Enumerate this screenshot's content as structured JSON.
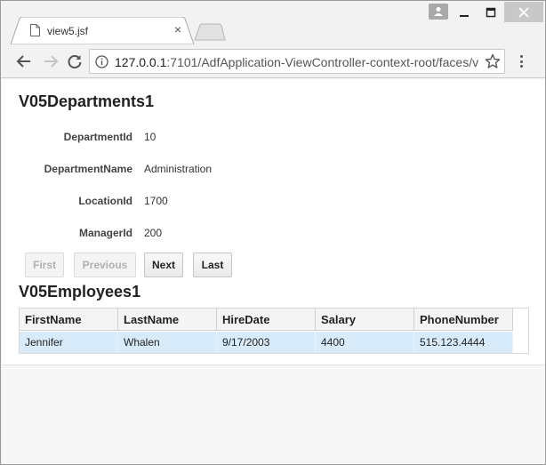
{
  "browser": {
    "tab_title": "view5.jsf",
    "tab_close": "×",
    "url_host": "127.0.0.1",
    "url_rest": ":7101/AdfApplication-ViewController-context-root/faces/v"
  },
  "departments": {
    "title": "V05Departments1",
    "fields": [
      {
        "label": "DepartmentId",
        "value": "10"
      },
      {
        "label": "DepartmentName",
        "value": "Administration"
      },
      {
        "label": "LocationId",
        "value": "1700"
      },
      {
        "label": "ManagerId",
        "value": "200"
      }
    ],
    "buttons": {
      "first": "First",
      "previous": "Previous",
      "next": "Next",
      "last": "Last"
    }
  },
  "employees": {
    "title": "V05Employees1",
    "columns": [
      "FirstName",
      "LastName",
      "HireDate",
      "Salary",
      "PhoneNumber"
    ],
    "rows": [
      [
        "Jennifer",
        "Whalen",
        "9/17/2003",
        "4400",
        "515.123.4444"
      ]
    ]
  },
  "colors": {
    "selected_row": "#d7ebfa",
    "header_bg": "#f4f4f4"
  }
}
